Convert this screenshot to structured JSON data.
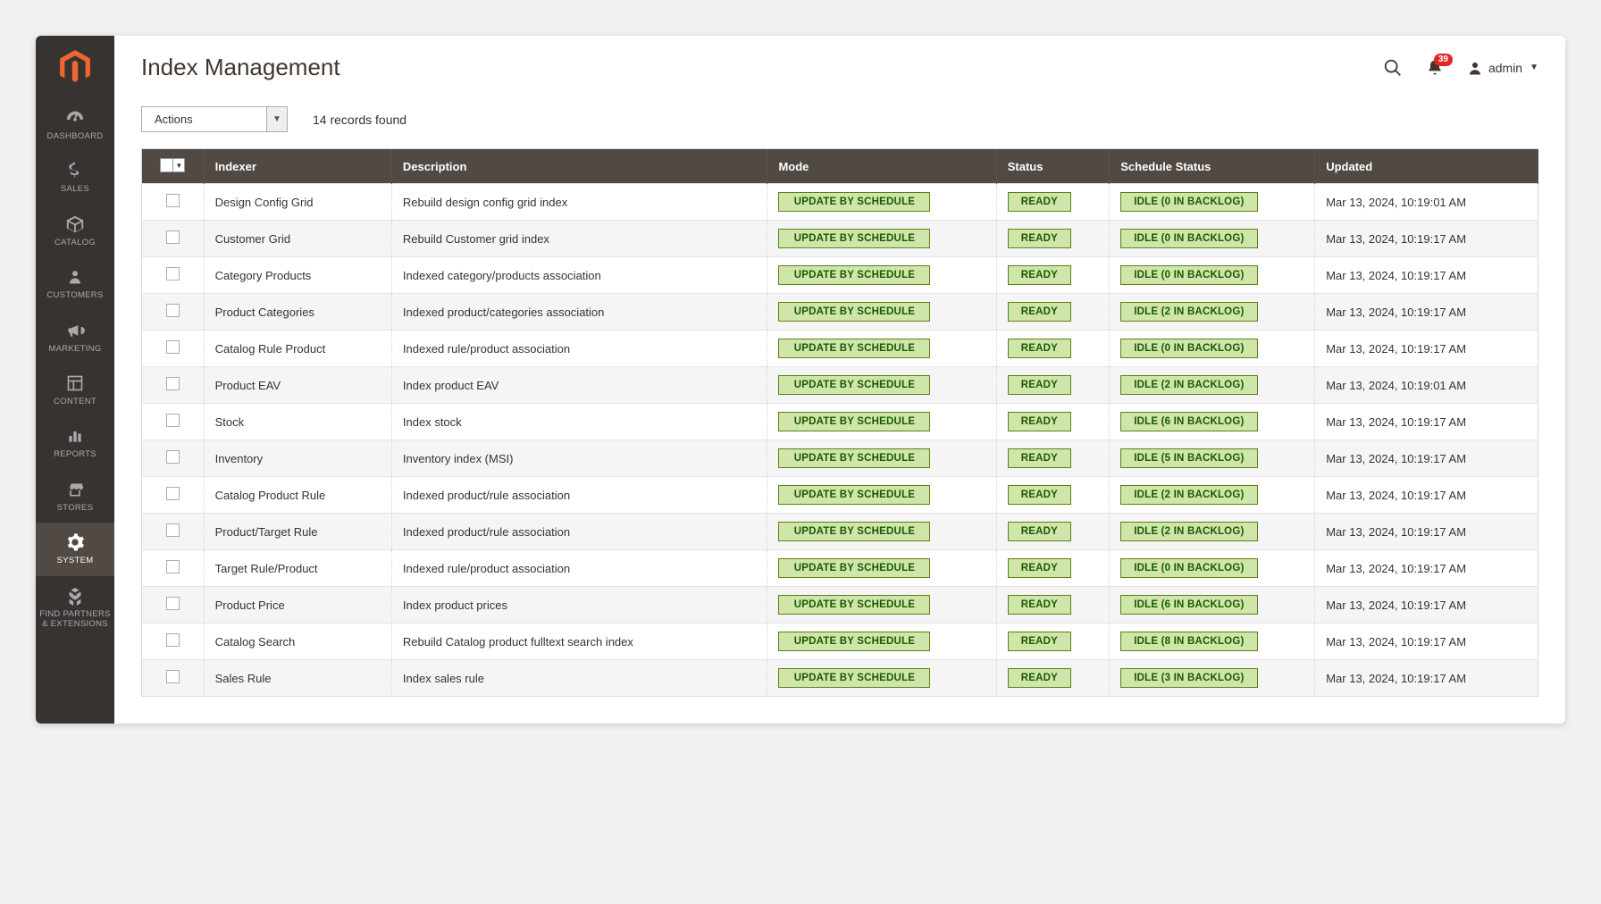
{
  "page": {
    "title": "Index Management",
    "actions_label": "Actions",
    "records_found": "14 records found"
  },
  "sidebar": {
    "items": [
      {
        "id": "dashboard",
        "label": "DASHBOARD",
        "icon": "gauge"
      },
      {
        "id": "sales",
        "label": "SALES",
        "icon": "dollar"
      },
      {
        "id": "catalog",
        "label": "CATALOG",
        "icon": "box"
      },
      {
        "id": "customers",
        "label": "CUSTOMERS",
        "icon": "person"
      },
      {
        "id": "marketing",
        "label": "MARKETING",
        "icon": "megaphone"
      },
      {
        "id": "content",
        "label": "CONTENT",
        "icon": "layout"
      },
      {
        "id": "reports",
        "label": "REPORTS",
        "icon": "chart"
      },
      {
        "id": "stores",
        "label": "STORES",
        "icon": "storefront"
      },
      {
        "id": "system",
        "label": "SYSTEM",
        "icon": "gear",
        "active": true
      },
      {
        "id": "partners",
        "label": "FIND PARTNERS & EXTENSIONS",
        "icon": "blocks"
      }
    ]
  },
  "header": {
    "notifications_count": "39",
    "user": "admin"
  },
  "table": {
    "headers": {
      "indexer": "Indexer",
      "description": "Description",
      "mode": "Mode",
      "status": "Status",
      "schedule_status": "Schedule Status",
      "updated": "Updated"
    },
    "rows": [
      {
        "indexer": "Design Config Grid",
        "description": "Rebuild design config grid index",
        "mode": "UPDATE BY SCHEDULE",
        "status": "READY",
        "schedule": "IDLE (0 IN BACKLOG)",
        "updated": "Mar 13, 2024, 10:19:01 AM"
      },
      {
        "indexer": "Customer Grid",
        "description": "Rebuild Customer grid index",
        "mode": "UPDATE BY SCHEDULE",
        "status": "READY",
        "schedule": "IDLE (0 IN BACKLOG)",
        "updated": "Mar 13, 2024, 10:19:17 AM"
      },
      {
        "indexer": "Category Products",
        "description": "Indexed category/products association",
        "mode": "UPDATE BY SCHEDULE",
        "status": "READY",
        "schedule": "IDLE (0 IN BACKLOG)",
        "updated": "Mar 13, 2024, 10:19:17 AM"
      },
      {
        "indexer": "Product Categories",
        "description": "Indexed product/categories association",
        "mode": "UPDATE BY SCHEDULE",
        "status": "READY",
        "schedule": "IDLE (2 IN BACKLOG)",
        "updated": "Mar 13, 2024, 10:19:17 AM"
      },
      {
        "indexer": "Catalog Rule Product",
        "description": "Indexed rule/product association",
        "mode": "UPDATE BY SCHEDULE",
        "status": "READY",
        "schedule": "IDLE (0 IN BACKLOG)",
        "updated": "Mar 13, 2024, 10:19:17 AM"
      },
      {
        "indexer": "Product EAV",
        "description": "Index product EAV",
        "mode": "UPDATE BY SCHEDULE",
        "status": "READY",
        "schedule": "IDLE (2 IN BACKLOG)",
        "updated": "Mar 13, 2024, 10:19:01 AM"
      },
      {
        "indexer": "Stock",
        "description": "Index stock",
        "mode": "UPDATE BY SCHEDULE",
        "status": "READY",
        "schedule": "IDLE (6 IN BACKLOG)",
        "updated": "Mar 13, 2024, 10:19:17 AM"
      },
      {
        "indexer": "Inventory",
        "description": "Inventory index (MSI)",
        "mode": "UPDATE BY SCHEDULE",
        "status": "READY",
        "schedule": "IDLE (5 IN BACKLOG)",
        "updated": "Mar 13, 2024, 10:19:17 AM"
      },
      {
        "indexer": "Catalog Product Rule",
        "description": "Indexed product/rule association",
        "mode": "UPDATE BY SCHEDULE",
        "status": "READY",
        "schedule": "IDLE (2 IN BACKLOG)",
        "updated": "Mar 13, 2024, 10:19:17 AM"
      },
      {
        "indexer": "Product/Target Rule",
        "description": "Indexed product/rule association",
        "mode": "UPDATE BY SCHEDULE",
        "status": "READY",
        "schedule": "IDLE (2 IN BACKLOG)",
        "updated": "Mar 13, 2024, 10:19:17 AM"
      },
      {
        "indexer": "Target Rule/Product",
        "description": "Indexed rule/product association",
        "mode": "UPDATE BY SCHEDULE",
        "status": "READY",
        "schedule": "IDLE (0 IN BACKLOG)",
        "updated": "Mar 13, 2024, 10:19:17 AM"
      },
      {
        "indexer": "Product Price",
        "description": "Index product prices",
        "mode": "UPDATE BY SCHEDULE",
        "status": "READY",
        "schedule": "IDLE (6 IN BACKLOG)",
        "updated": "Mar 13, 2024, 10:19:17 AM"
      },
      {
        "indexer": "Catalog Search",
        "description": "Rebuild Catalog product fulltext search index",
        "mode": "UPDATE BY SCHEDULE",
        "status": "READY",
        "schedule": "IDLE (8 IN BACKLOG)",
        "updated": "Mar 13, 2024, 10:19:17 AM"
      },
      {
        "indexer": "Sales Rule",
        "description": "Index sales rule",
        "mode": "UPDATE BY SCHEDULE",
        "status": "READY",
        "schedule": "IDLE (3 IN BACKLOG)",
        "updated": "Mar 13, 2024, 10:19:17 AM"
      }
    ]
  },
  "colors": {
    "sidebar_bg": "#373330",
    "sidebar_active": "#514943",
    "accent_orange": "#ef672f",
    "badge_bg": "#d0e5a9",
    "badge_border": "#5b8116",
    "badge_text": "#185b00",
    "notif_red": "#e22626"
  }
}
